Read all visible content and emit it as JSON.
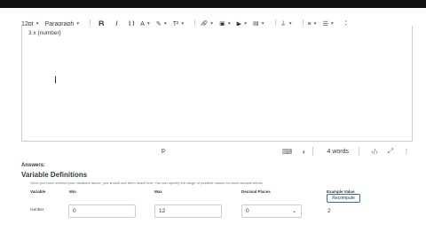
{
  "toolbar": {
    "font_size": "12pt",
    "paragraph": "Paragraph",
    "bold": "B",
    "italic": "I",
    "underline": "U",
    "text_color": "A",
    "superscript": "T²"
  },
  "editor": {
    "content": "3 x {number}"
  },
  "statusbar": {
    "path": "p",
    "word_count": "4 words"
  },
  "answers": {
    "heading": "Answers:",
    "section_title": "Variable Definitions",
    "description": "Once you have entered your variables above, you should see them listed here. You can specify the range of possible values for each variable below.",
    "columns": {
      "variable": "Variable",
      "min": "Min",
      "max": "Max",
      "decimal_places": "Decimal Places",
      "example_value": "Example Value"
    },
    "rows": [
      {
        "variable": "number",
        "min": "0",
        "max": "12",
        "decimal_places": "0",
        "example": "2"
      }
    ],
    "recompute_label": "Recompute"
  },
  "colors": {
    "text": "#2d3b45",
    "border": "#c7cdd1",
    "accent": "#2d6fb6"
  }
}
